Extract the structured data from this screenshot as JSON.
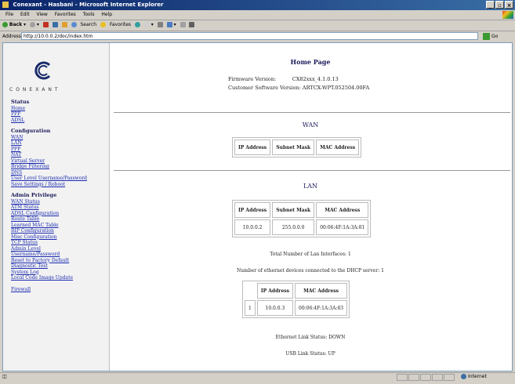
{
  "window": {
    "title": "Conexant - Hasbani - Microsoft Internet Explorer"
  },
  "menu": [
    "File",
    "Edit",
    "View",
    "Favorites",
    "Tools",
    "Help"
  ],
  "toolbar": {
    "back": "Back",
    "search": "Search",
    "favorites": "Favorites"
  },
  "address": {
    "label": "Address",
    "url": "http://10.0.0.2/doc/index.htm",
    "go": "Go"
  },
  "logo": {
    "text": "CONEXANT"
  },
  "sidebar": {
    "status": {
      "header": "Status",
      "items": [
        "Home",
        "PPP",
        "ADSL"
      ]
    },
    "config": {
      "header": "Configuration",
      "items": [
        "WAN",
        "LAN",
        "PPP",
        "NAT",
        "Virtual Server",
        "Bridge Filtering",
        "DNS",
        "User Level Username/Password",
        "Save Settings / Reboot"
      ]
    },
    "admin": {
      "header": "Admin Privilege",
      "items": [
        "WAN Status",
        "ATM Status",
        "ADSL Configuration",
        "Route Table",
        "Learned MAC Table",
        "RIP Configuration",
        "Misc Configuration",
        "TCP Status",
        "Admin Level",
        "Username/Password",
        "Reset to Factory Default",
        "Diagnostic Test",
        "System Log",
        "Local Code Image Update"
      ]
    },
    "firewall": "Firewall"
  },
  "main": {
    "title": "Home Page",
    "firmware_label": "Firmware Version:",
    "firmware_value": "CX82xxx_4.1.0.13",
    "customer_label": "Customer Software Version:",
    "customer_value": "ARTCX-WPT.052504.00FA",
    "wan": {
      "title": "WAN",
      "headers": [
        "IP Address",
        "Subnet Mask",
        "MAC Address"
      ]
    },
    "lan": {
      "title": "LAN",
      "headers": [
        "IP Address",
        "Subnet Mask",
        "MAC Address"
      ],
      "row": [
        "10.0.0.2",
        "255.0.0.0",
        "00:06:4F:1A:3A:81"
      ]
    },
    "lan_count": "Total Number of Lan Interfaces: 1",
    "dhcp_count": "Number of ethernet devices connected to the DHCP server: 1",
    "dhcp": {
      "headers": [
        "IP Address",
        "MAC Address"
      ],
      "row": [
        "1",
        "10.0.0.3",
        "00:06:4F:1A:3A:83"
      ]
    },
    "ethernet_status": "Ethernet Link Status: DOWN",
    "usb_status": "USB Link Status: UP"
  },
  "status_bar": {
    "zone": "Internet"
  }
}
